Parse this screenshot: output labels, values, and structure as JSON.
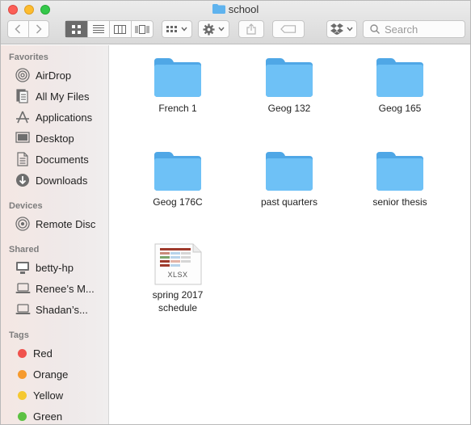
{
  "window": {
    "title": "school"
  },
  "toolbar": {
    "search_placeholder": "Search"
  },
  "sidebar": {
    "favorites_header": "Favorites",
    "favorites": [
      {
        "label": "AirDrop",
        "icon": "airdrop-icon"
      },
      {
        "label": "All My Files",
        "icon": "all-files-icon"
      },
      {
        "label": "Applications",
        "icon": "applications-icon"
      },
      {
        "label": "Desktop",
        "icon": "desktop-icon"
      },
      {
        "label": "Documents",
        "icon": "documents-icon"
      },
      {
        "label": "Downloads",
        "icon": "downloads-icon"
      }
    ],
    "devices_header": "Devices",
    "devices": [
      {
        "label": "Remote Disc",
        "icon": "disc-icon"
      }
    ],
    "shared_header": "Shared",
    "shared": [
      {
        "label": "betty-hp",
        "icon": "monitor-icon"
      },
      {
        "label": "Renee’s M...",
        "icon": "laptop-icon"
      },
      {
        "label": "Shadan’s...",
        "icon": "laptop-icon"
      }
    ],
    "tags_header": "Tags",
    "tags": [
      {
        "label": "Red",
        "color": "#f0524d"
      },
      {
        "label": "Orange",
        "color": "#f69a2d"
      },
      {
        "label": "Yellow",
        "color": "#f5c830"
      },
      {
        "label": "Green",
        "color": "#5cc142"
      }
    ]
  },
  "files": [
    {
      "name": "French 1",
      "kind": "folder"
    },
    {
      "name": "Geog 132",
      "kind": "folder"
    },
    {
      "name": "Geog 165",
      "kind": "folder"
    },
    {
      "name": "Geog 176C",
      "kind": "folder"
    },
    {
      "name": "past quarters",
      "kind": "folder"
    },
    {
      "name": "senior thesis",
      "kind": "folder"
    },
    {
      "name_line1": "spring 2017",
      "name_line2": "schedule",
      "kind": "xlsx",
      "badge": "XLSX"
    }
  ]
}
